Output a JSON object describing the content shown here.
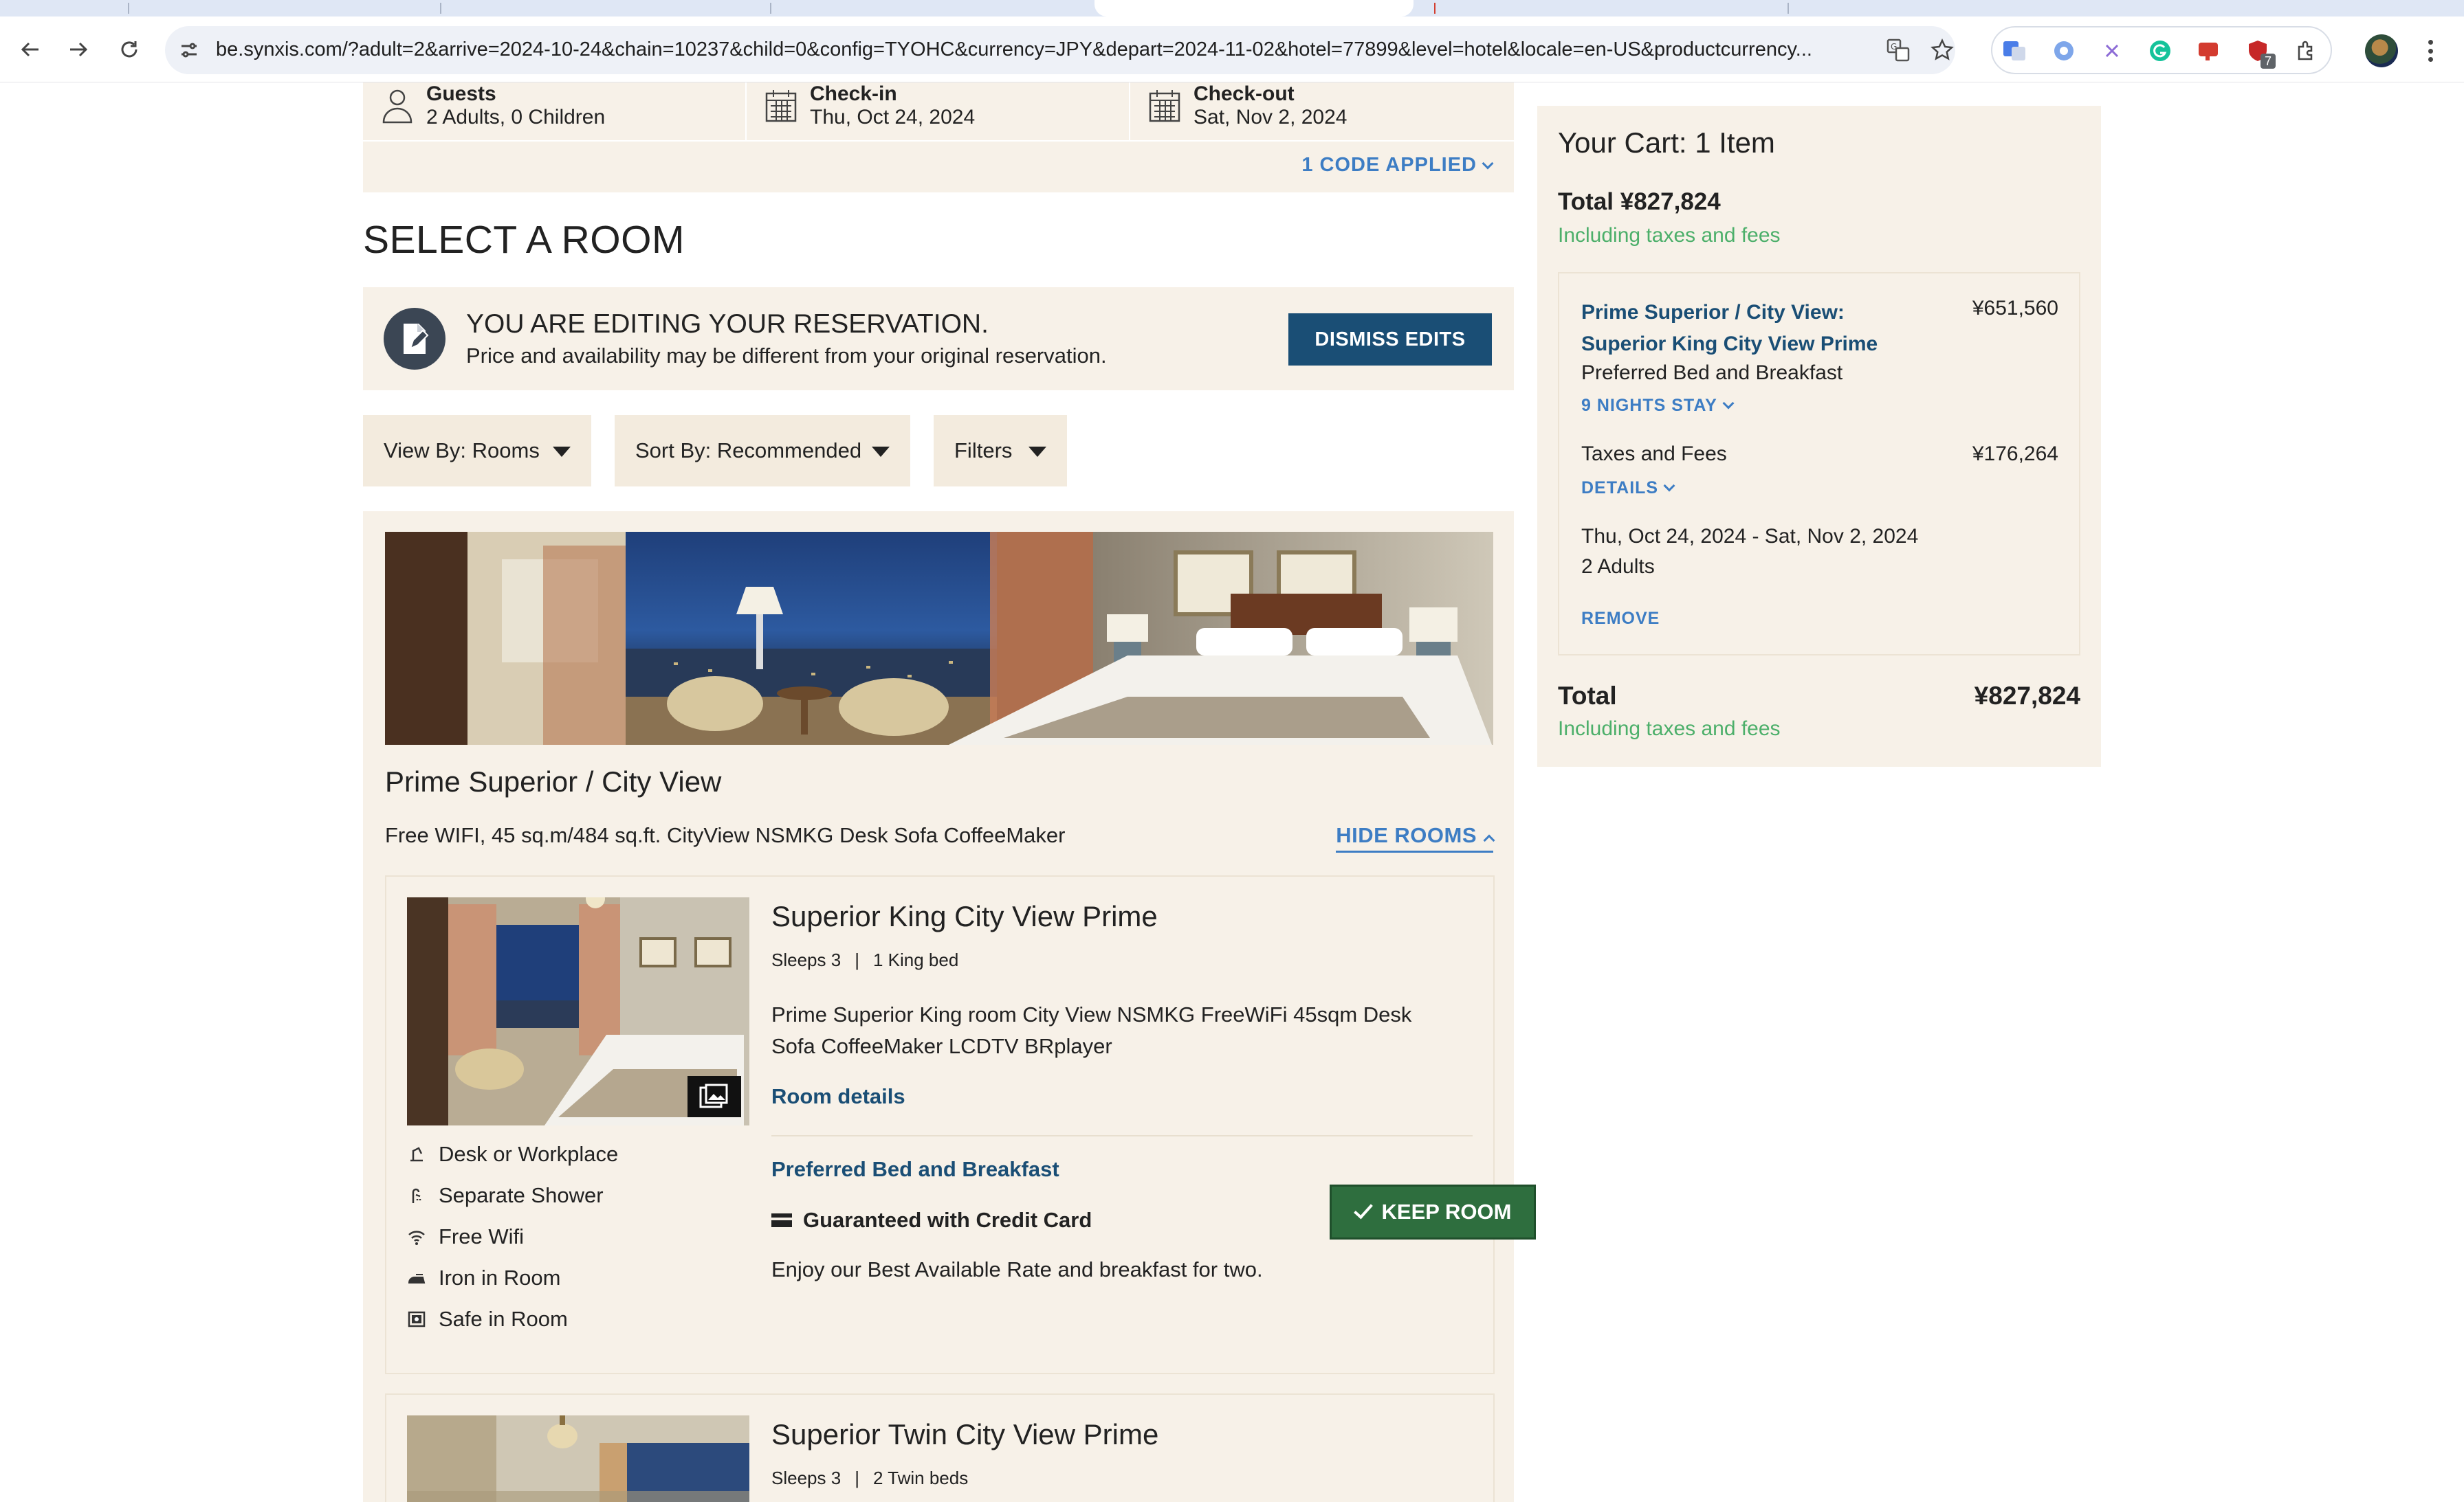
{
  "browser": {
    "url": "be.synxis.com/?adult=2&arrive=2024-10-24&chain=10237&child=0&config=TYOHC&currency=JPY&depart=2024-11-02&hotel=77899&level=hotel&locale=en-US&productcurrency...",
    "extension_badge": "7",
    "icons": [
      "back-icon",
      "forward-icon",
      "reload-icon",
      "site-settings-icon",
      "translate-icon",
      "star-icon",
      "extensions-icon",
      "more-icon"
    ]
  },
  "search": {
    "guests_label": "Guests",
    "guests_value": "2 Adults, 0 Children",
    "checkin_label": "Check-in",
    "checkin_value": "Thu, Oct 24, 2024",
    "checkout_label": "Check-out",
    "checkout_value": "Sat, Nov 2, 2024",
    "code_applied": "1 CODE APPLIED"
  },
  "page_title": "SELECT A ROOM",
  "edit_banner": {
    "heading": "YOU ARE EDITING YOUR RESERVATION.",
    "subtext": "Price and availability may be different from your original reservation.",
    "dismiss": "DISMISS EDITS"
  },
  "filters": {
    "view_by": "View By: Rooms",
    "sort_by": "Sort By: Recommended",
    "filters": "Filters"
  },
  "room_type": {
    "name": "Prime Superior / City View",
    "amenities": "Free WIFI, 45 sq.m/484 sq.ft. CityView NSMKG Desk Sofa CoffeeMaker",
    "hide_rooms": "HIDE ROOMS"
  },
  "rooms": [
    {
      "title": "Superior King City View Prime",
      "sleeps": "Sleeps 3",
      "sep": "|",
      "beds": "1 King bed",
      "description": "Prime Superior King room City View NSMKG FreeWiFi 45sqm Desk Sofa CoffeeMaker LCDTV BRplayer",
      "details_link": "Room details",
      "rate_name": "Preferred Bed and Breakfast",
      "guarantee": "Guaranteed with Credit Card",
      "rate_desc": "Enjoy our Best Available Rate and breakfast for two.",
      "action": "KEEP ROOM",
      "amenities": [
        {
          "icon": "desk-icon",
          "label": "Desk or Workplace"
        },
        {
          "icon": "shower-icon",
          "label": "Separate Shower"
        },
        {
          "icon": "wifi-icon",
          "label": "Free Wifi"
        },
        {
          "icon": "iron-icon",
          "label": "Iron in Room"
        },
        {
          "icon": "safe-icon",
          "label": "Safe in Room"
        }
      ]
    },
    {
      "title": "Superior Twin City View Prime",
      "sleeps": "Sleeps 3",
      "sep": "|",
      "beds": "2 Twin beds"
    }
  ],
  "cart": {
    "title": "Your Cart: 1 Item",
    "total": "Total ¥827,824",
    "including": "Including taxes and fees",
    "item_name": "Prime Superior / City View: Superior King City View Prime",
    "item_price": "¥651,560",
    "rate": "Preferred Bed and Breakfast",
    "nights": "9 NIGHTS STAY",
    "taxes_label": "Taxes and Fees",
    "taxes_value": "¥176,264",
    "details": "DETAILS",
    "dates": "Thu, Oct 24, 2024 - Sat, Nov 2, 2024",
    "adults": "2 Adults",
    "remove": "REMOVE",
    "footer_total_label": "Total",
    "footer_total_value": "¥827,824",
    "footer_including": "Including taxes and fees"
  },
  "colors": {
    "panel_beige": "#f7f1e8",
    "navy": "#1a4e75",
    "link_blue": "#3d7dc4",
    "keep_green": "#2e6e3e",
    "taxes_green": "#4caf6a"
  }
}
